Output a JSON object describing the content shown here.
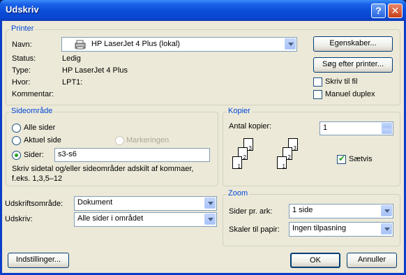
{
  "window": {
    "title": "Udskriv",
    "help": "?",
    "close": "✕"
  },
  "printer": {
    "group_label": "Printer",
    "name_label": "Navn:",
    "name_value": "HP LaserJet 4 Plus (lokal)",
    "status_label": "Status:",
    "status_value": "Ledig",
    "type_label": "Type:",
    "type_value": "HP LaserJet 4 Plus",
    "where_label": "Hvor:",
    "where_value": "LPT1:",
    "comment_label": "Kommentar:",
    "properties_button": "Egenskaber...",
    "find_button": "Søg efter printer...",
    "print_to_file": "Skriv til fil",
    "manual_duplex": "Manuel duplex"
  },
  "range": {
    "group_label": "Sideområde",
    "all": "Alle sider",
    "current": "Aktuel side",
    "selection": "Markeringen",
    "pages": "Sider:",
    "pages_value": "s3-s6",
    "hint_line1": "Skriv sidetal og/eller sideområder adskilt af kommaer,",
    "hint_line2": "f.eks. 1,3,5–12"
  },
  "copies": {
    "group_label": "Kopier",
    "count_label": "Antal kopier:",
    "count_value": "1",
    "collate": "Sætvis",
    "page_labels": [
      "1",
      "2",
      "3"
    ]
  },
  "print_what": {
    "label": "Udskriftsområde:",
    "value": "Dokument"
  },
  "print_which": {
    "label": "Udskriv:",
    "value": "Alle sider i området"
  },
  "zoom": {
    "group_label": "Zoom",
    "pages_per_sheet_label": "Sider pr. ark:",
    "pages_per_sheet_value": "1 side",
    "scale_label": "Skaler til papir:",
    "scale_value": "Ingen tilpasning"
  },
  "buttons": {
    "options": "Indstillinger...",
    "ok": "OK",
    "cancel": "Annuller"
  }
}
